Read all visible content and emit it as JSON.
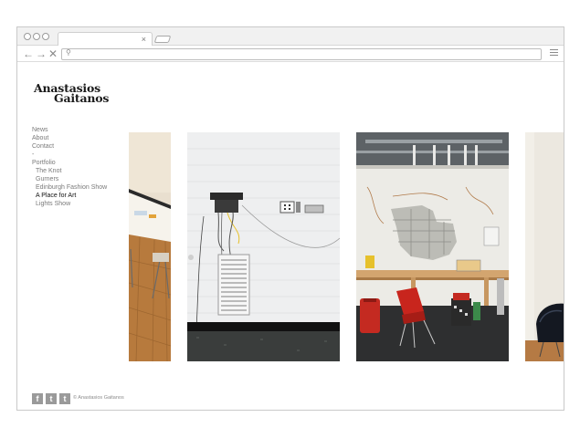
{
  "browser": {
    "tab_close": "×",
    "back": "←",
    "forward": "→",
    "stop": "✕",
    "search_glyph": "⚲"
  },
  "site": {
    "logo_line1": "Anastasios",
    "logo_line2": "Gaitanos",
    "nav": {
      "news": "News",
      "about": "About",
      "contact": "Contact",
      "separator": "-",
      "portfolio": "Portfolio",
      "items": [
        "The Knot",
        "Gurners",
        "Edinburgh Fashion Show",
        "A Place for Art",
        "Lights Show"
      ],
      "active_item": "A Place for Art"
    },
    "gallery": [
      {
        "name": "workshop-floor"
      },
      {
        "name": "white-wall-wires"
      },
      {
        "name": "studio-workbench"
      },
      {
        "name": "chair-corner"
      }
    ],
    "footer": {
      "facebook": "f",
      "twitter": "t",
      "tumblr": "t",
      "copyright": "© Anastasios Gaitanos"
    }
  }
}
